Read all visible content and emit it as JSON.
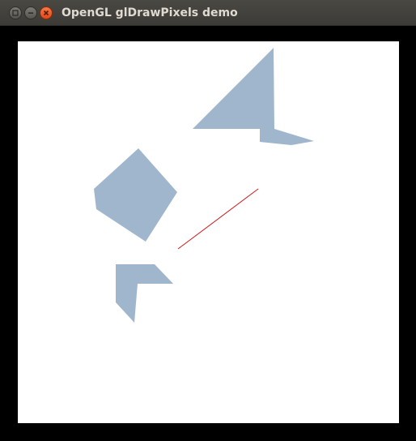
{
  "window": {
    "title": "OpenGL glDrawPixels demo",
    "controls": [
      "maximize-icon",
      "minimize-icon",
      "close-icon"
    ]
  },
  "colors": {
    "background": "#000000",
    "viewport": "#ffffff",
    "shape_fill": "#a0b6cd",
    "line": "#d01818"
  }
}
